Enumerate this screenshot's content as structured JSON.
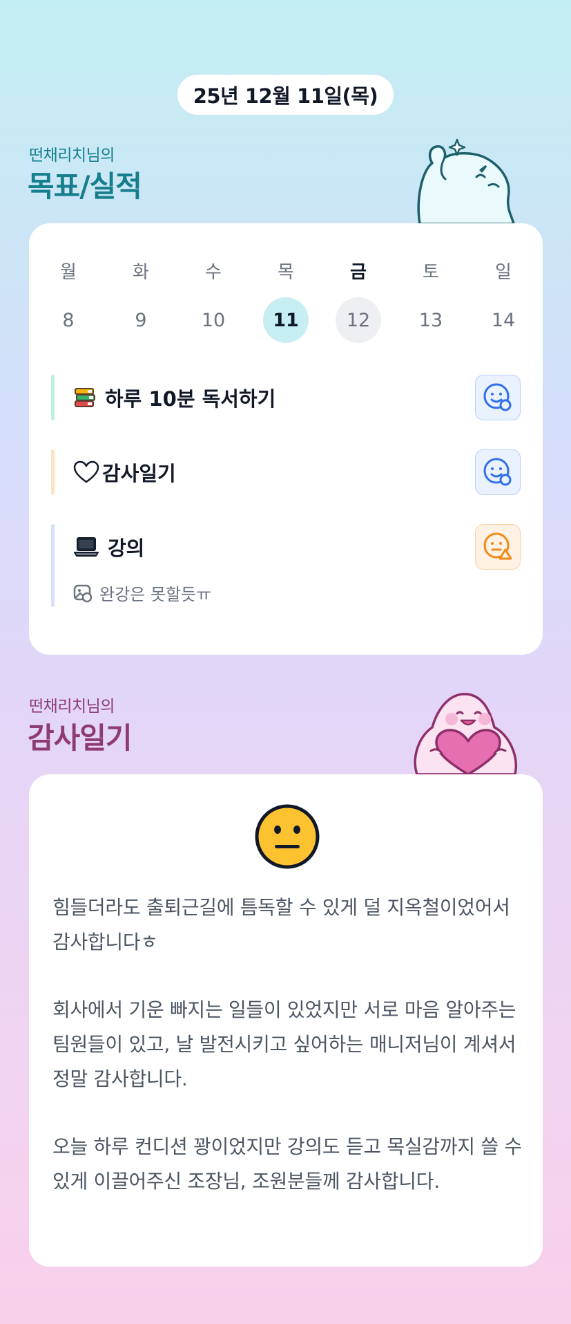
{
  "header": {
    "date": "25년 12월 11일(목)"
  },
  "goals_section": {
    "subtitle": "떤채리치님의",
    "title": "목표/실적"
  },
  "calendar": {
    "days": [
      "월",
      "화",
      "수",
      "목",
      "금",
      "토",
      "일"
    ],
    "dates": [
      "8",
      "9",
      "10",
      "11",
      "12",
      "13",
      "14"
    ],
    "today_index": 3,
    "selected_index": 4
  },
  "goals": [
    {
      "label": "하루 10분 독서하기",
      "icon": "books-icon",
      "bar_color": "#bdf0dc",
      "mood": "smile-check-icon"
    },
    {
      "label": "감사일기",
      "icon": "heart-outline-icon",
      "bar_color": "#fde3c4",
      "mood": "smile-check-icon"
    },
    {
      "label": "강의",
      "icon": "laptop-icon",
      "bar_color": "#d6e0fb",
      "mood": "neutral-warning-icon",
      "memo": "완강은 못할듯ㅠ"
    }
  ],
  "gratitude_section": {
    "subtitle": "떤채리치님의",
    "title": "감사일기"
  },
  "diary": {
    "emoji": "neutral-face-icon",
    "paragraphs": [
      "힘들더라도 출퇴근길에 틈독할 수 있게 덜 지옥철이었어서 감사합니다ㅎ",
      "회사에서 기운 빠지는 일들이 있었지만 서로 마음 알아주는 팀원들이 있고, 날 발전시키고 싶어하는 매니저님이 계셔서 정말 감사합니다.",
      "오늘 하루 컨디션 꽝이었지만 강의도 듣고 목실감까지 쓸 수 있게 이끌어주신 조장님, 조원분들께 감사합니다."
    ]
  },
  "colors": {
    "teal": "#167e8c",
    "plum": "#8e3b72",
    "today": "#c6eef3",
    "mood_blue": "#2f6fe8",
    "mood_orange": "#f08a1a"
  }
}
